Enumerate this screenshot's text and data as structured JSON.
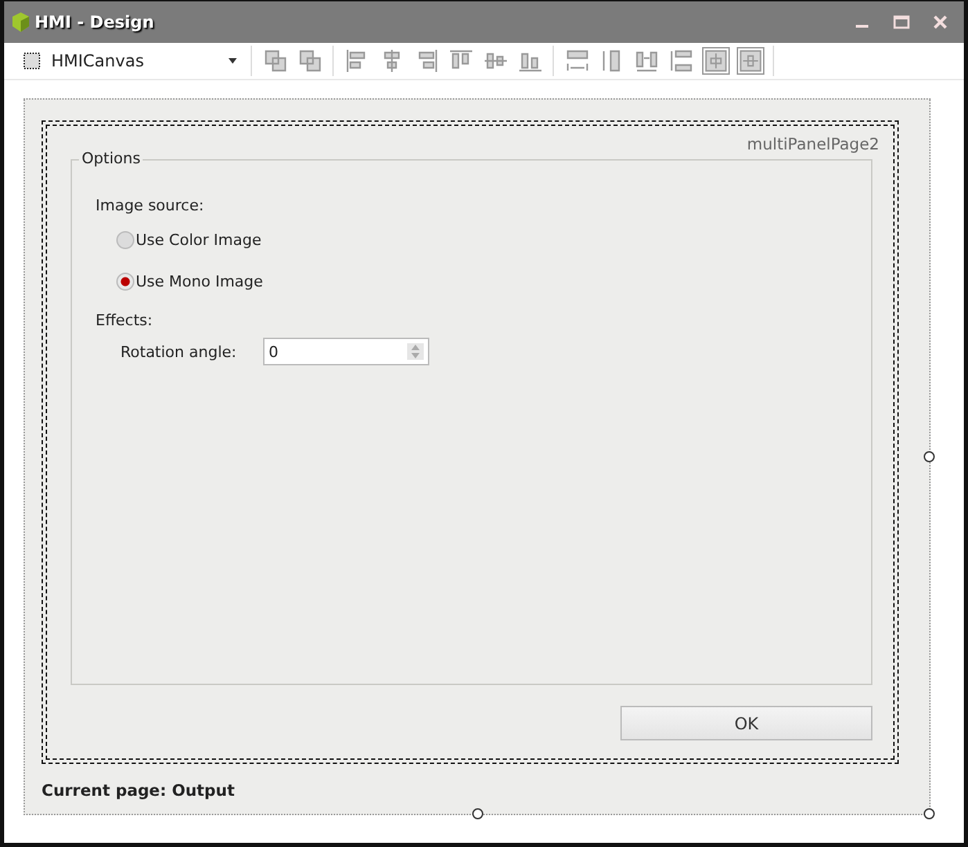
{
  "window": {
    "title": "HMI - Design"
  },
  "toolbar": {
    "component_selector": "HMICanvas"
  },
  "page": {
    "name": "multiPanelPage2",
    "group": {
      "title": "Options",
      "image_source_label": "Image source:",
      "radios": [
        {
          "label": "Use Color Image",
          "selected": false
        },
        {
          "label": "Use Mono Image",
          "selected": true
        }
      ],
      "effects_label": "Effects:",
      "rotation_label": "Rotation angle:",
      "rotation_value": "0"
    },
    "ok_button": "OK"
  },
  "status": "Current page: Output"
}
